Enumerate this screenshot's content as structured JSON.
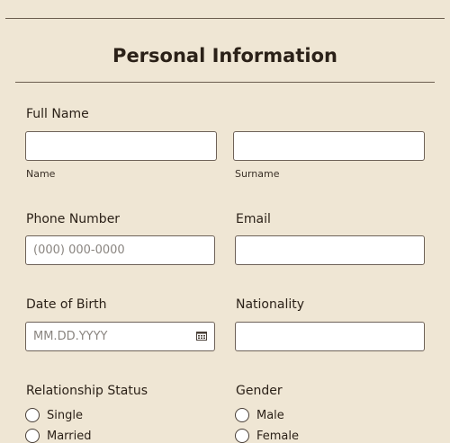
{
  "form": {
    "title": "Personal Information",
    "full_name": {
      "label": "Full Name",
      "name_sub": "Name",
      "surname_sub": "Surname"
    },
    "phone": {
      "label": "Phone Number",
      "placeholder": "(000) 000-0000"
    },
    "email": {
      "label": "Email"
    },
    "dob": {
      "label": "Date of Birth",
      "placeholder": "MM.DD.YYYY"
    },
    "nationality": {
      "label": "Nationality"
    },
    "relationship": {
      "label": "Relationship Status",
      "options": [
        "Single",
        "Married"
      ]
    },
    "gender": {
      "label": "Gender",
      "options": [
        "Male",
        "Female"
      ]
    }
  },
  "colors": {
    "background": "#efe6d4",
    "text": "#2b2118",
    "border": "#6e6258"
  }
}
